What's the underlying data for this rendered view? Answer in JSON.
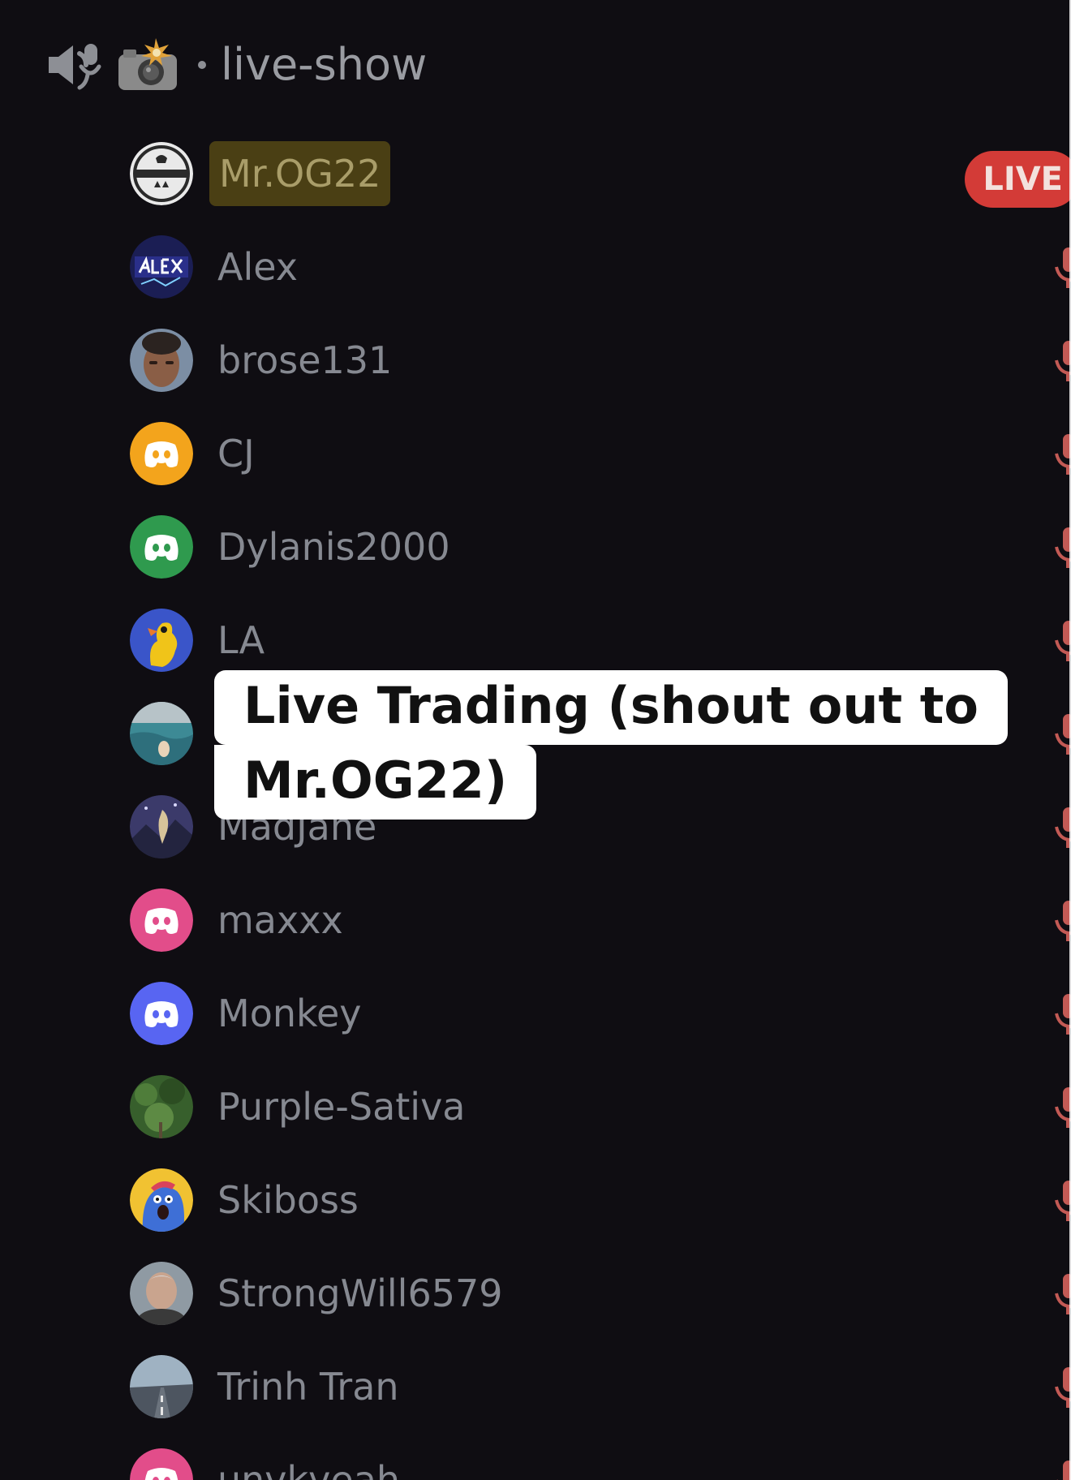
{
  "channel": {
    "speaker_icon": "speaker-voice-icon",
    "emoji_icon": "camera-flash-icon",
    "name": "live-show"
  },
  "users": [
    {
      "name": "Mr.OG22",
      "host": true,
      "badge": "LIVE",
      "avatar": "badge-logo",
      "avatar_color": "#e9e9e9"
    },
    {
      "name": "Alex",
      "avatar": "alex-neon-logo",
      "avatar_color": "#1b1e54",
      "mic": "muted"
    },
    {
      "name": "brose131",
      "avatar": "photo-portrait",
      "avatar_color": "#8a6a5a",
      "mic": "muted"
    },
    {
      "name": "CJ",
      "avatar": "discord-default",
      "avatar_color": "#f3a41c",
      "mic": "muted"
    },
    {
      "name": "Dylanis2000",
      "avatar": "discord-default",
      "avatar_color": "#2f9a4e",
      "mic": "muted"
    },
    {
      "name": "LA",
      "avatar": "cartoon-duck",
      "avatar_color": "#3a55c9",
      "mic": "muted"
    },
    {
      "name": "",
      "avatar": "photo-beach",
      "avatar_color": "#3d8a95",
      "mic": "muted"
    },
    {
      "name": "MadJane",
      "avatar": "photo-night-sky",
      "avatar_color": "#3b3a6a",
      "mic": "muted"
    },
    {
      "name": "maxxx",
      "avatar": "discord-default",
      "avatar_color": "#e24d8a",
      "mic": "muted"
    },
    {
      "name": "Monkey",
      "avatar": "discord-default",
      "avatar_color": "#5865f2",
      "mic": "muted"
    },
    {
      "name": "Purple-Sativa",
      "avatar": "photo-forest",
      "avatar_color": "#375f2c",
      "mic": "muted"
    },
    {
      "name": "Skiboss",
      "avatar": "cartoon-blue-creature",
      "avatar_color": "#f1c232",
      "mic": "muted"
    },
    {
      "name": "StrongWill6579",
      "avatar": "photo-man",
      "avatar_color": "#9a8a80",
      "mic": "muted"
    },
    {
      "name": "Trinh Tran",
      "avatar": "photo-road-hope",
      "avatar_color": "#6f7f8e",
      "mic": "muted"
    },
    {
      "name": "unvkveah",
      "avatar": "discord-default",
      "avatar_color": "#e24d8a",
      "mic": "muted"
    }
  ],
  "caption": {
    "line1": "Live Trading (shout out to",
    "line2": "Mr.OG22)"
  },
  "colors": {
    "background": "#0f0d12",
    "live_badge": "#d33b37",
    "muted_mic": "#c35a55",
    "host_highlight": "#4a3f14"
  }
}
